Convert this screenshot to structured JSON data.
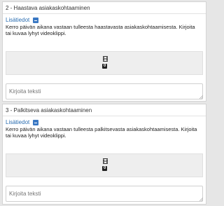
{
  "questions": [
    {
      "title": "2 - Haastava asiakaskohtaaminen",
      "info_link": "Lisätiedot",
      "description": "Kerro päivän aikana vastaan tulleesta haastavasta asiakaskohtaamisesta. Kirjoita tai kuvaa lyhyt videoklippi.",
      "media_count": "0",
      "input_placeholder": "Kirjoita teksti"
    },
    {
      "title": "3 - Palkitseva asiakaskohtaaminen",
      "info_link": "Lisätiedot",
      "description": "Kerro päivän aikana vastaan tulleesta palkitsevasta asiakaskohtaamisesta. Kirjoita tai kuvaa lyhyt videoklippi.",
      "media_count": "0",
      "input_placeholder": "Kirjoita teksti"
    }
  ],
  "icons": {
    "toggle": "collapse-icon",
    "media": "film-icon"
  },
  "colors": {
    "link": "#2a6db0",
    "toggle": "#3a78c3",
    "badge": "#222222"
  }
}
